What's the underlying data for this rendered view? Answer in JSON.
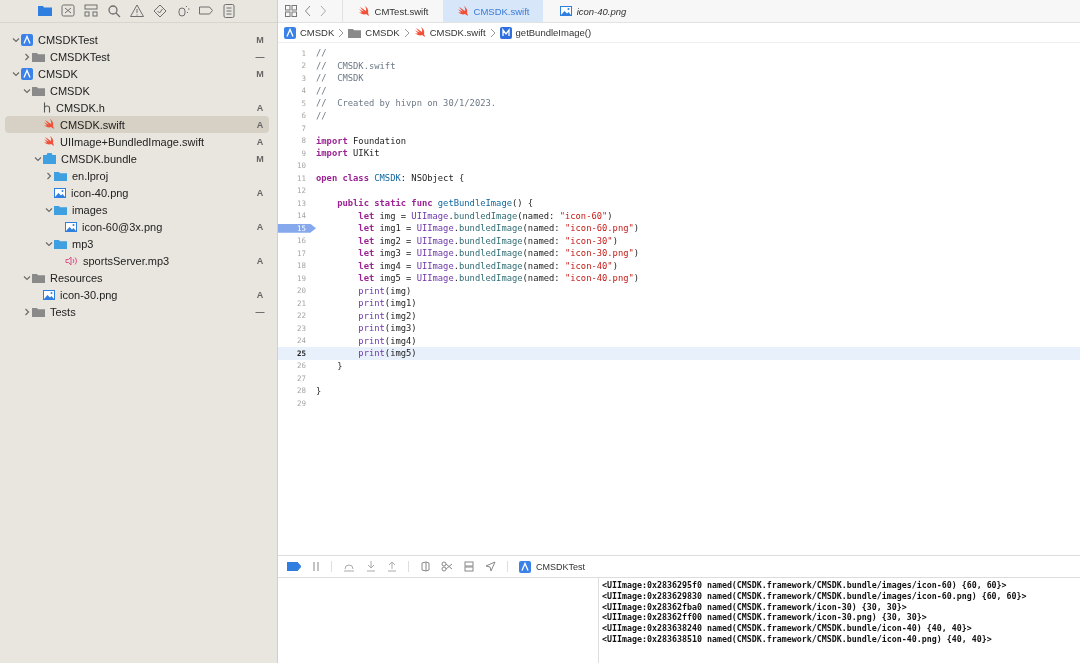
{
  "navigator_tabs": [
    {
      "kind": "folder",
      "selected": true
    },
    {
      "kind": "source-control",
      "selected": false
    },
    {
      "kind": "hierarchy",
      "selected": false
    },
    {
      "kind": "search",
      "selected": false
    },
    {
      "kind": "warning",
      "selected": false
    },
    {
      "kind": "test",
      "selected": false
    },
    {
      "kind": "debug",
      "selected": false
    },
    {
      "kind": "breakpoint",
      "selected": false
    },
    {
      "kind": "report",
      "selected": false
    }
  ],
  "tree": [
    {
      "label": "CMSDKTest",
      "kind": "project",
      "status": "M",
      "expanded": true,
      "selected": false,
      "children": [
        {
          "label": "CMSDKTest",
          "kind": "folder",
          "status": "—",
          "expanded": false,
          "selected": false
        }
      ]
    },
    {
      "label": "CMSDK",
      "kind": "project",
      "status": "M",
      "expanded": true,
      "selected": false,
      "children": [
        {
          "label": "CMSDK",
          "kind": "folder",
          "expanded": true,
          "selected": false,
          "children": [
            {
              "label": "CMSDK.h",
              "kind": "header",
              "status": "A",
              "selected": false
            },
            {
              "label": "CMSDK.swift",
              "kind": "swift",
              "status": "A",
              "selected": true
            },
            {
              "label": "UIImage+BundledImage.swift",
              "kind": "swift",
              "status": "A",
              "selected": false
            },
            {
              "label": "CMSDK.bundle",
              "kind": "bundle",
              "status": "M",
              "expanded": true,
              "selected": false,
              "children": [
                {
                  "label": "en.lproj",
                  "kind": "bluefolder",
                  "expanded": false,
                  "selected": false
                },
                {
                  "label": "icon-40.png",
                  "kind": "image",
                  "status": "A",
                  "selected": false
                },
                {
                  "label": "images",
                  "kind": "bluefolder",
                  "expanded": true,
                  "selected": false,
                  "children": [
                    {
                      "label": "icon-60@3x.png",
                      "kind": "image",
                      "status": "A",
                      "selected": false
                    }
                  ]
                },
                {
                  "label": "mp3",
                  "kind": "bluefolder",
                  "expanded": true,
                  "selected": false,
                  "children": [
                    {
                      "label": "sportsServer.mp3",
                      "kind": "audio",
                      "status": "A",
                      "selected": false
                    }
                  ]
                }
              ]
            }
          ]
        },
        {
          "label": "Resources",
          "kind": "folder",
          "expanded": true,
          "selected": false,
          "children": [
            {
              "label": "icon-30.png",
              "kind": "image",
              "status": "A",
              "selected": false
            }
          ]
        },
        {
          "label": "Tests",
          "kind": "folder",
          "status": "—",
          "expanded": false,
          "selected": false
        }
      ]
    }
  ],
  "tabs": [
    {
      "label": "CMTest.swift",
      "kind": "swift",
      "preview": false,
      "selected": false
    },
    {
      "label": "CMSDK.swift",
      "kind": "swift",
      "preview": false,
      "selected": true
    },
    {
      "label": "icon-40.png",
      "kind": "image",
      "preview": true,
      "selected": false
    }
  ],
  "breadcrumb": [
    {
      "label": "CMSDK",
      "kind": "project"
    },
    {
      "label": "CMSDK",
      "kind": "folder"
    },
    {
      "label": "CMSDK.swift",
      "kind": "swift"
    },
    {
      "label": "getBundleImage()",
      "kind": "method"
    }
  ],
  "code_lines": [
    {
      "number": "1",
      "tokens": [
        {
          "kind": "comment",
          "text": "//"
        }
      ]
    },
    {
      "number": "2",
      "tokens": [
        {
          "kind": "comment",
          "text": "//  CMSDK.swift"
        }
      ]
    },
    {
      "number": "3",
      "tokens": [
        {
          "kind": "comment",
          "text": "//  CMSDK"
        }
      ]
    },
    {
      "number": "4",
      "tokens": [
        {
          "kind": "comment",
          "text": "//"
        }
      ]
    },
    {
      "number": "5",
      "tokens": [
        {
          "kind": "comment",
          "text": "//  Created by hivpn on 30/1/2023."
        }
      ]
    },
    {
      "number": "6",
      "tokens": [
        {
          "kind": "comment",
          "text": "//"
        }
      ]
    },
    {
      "number": "7"
    },
    {
      "number": "8",
      "tokens": [
        {
          "kind": "keyword",
          "text": "import"
        },
        {
          "kind": "plain",
          "text": " Foundation"
        }
      ]
    },
    {
      "number": "9",
      "tokens": [
        {
          "kind": "keyword",
          "text": "import"
        },
        {
          "kind": "plain",
          "text": " UIKit"
        }
      ]
    },
    {
      "number": "10"
    },
    {
      "number": "11",
      "tokens": [
        {
          "kind": "keyword",
          "text": "open"
        },
        {
          "kind": "keyword",
          "text": " class"
        },
        {
          "kind": "declaration",
          "text": " CMSDK"
        },
        {
          "kind": "plain",
          "text": ": NSObject {"
        }
      ]
    },
    {
      "number": "12"
    },
    {
      "number": "13",
      "tokens": [
        {
          "kind": "keyword",
          "text": "    public"
        },
        {
          "kind": "keyword",
          "text": " static"
        },
        {
          "kind": "keyword",
          "text": " func"
        },
        {
          "kind": "declaration",
          "text": " getBundleImage"
        },
        {
          "kind": "plain",
          "text": "() {"
        }
      ]
    },
    {
      "number": "14",
      "tokens": [
        {
          "kind": "keyword",
          "text": "        let"
        },
        {
          "kind": "plain",
          "text": " img = "
        },
        {
          "kind": "type",
          "text": "UIImage"
        },
        {
          "kind": "plain",
          "text": "."
        },
        {
          "kind": "call",
          "text": "bundledImage"
        },
        {
          "kind": "plain",
          "text": "(named: "
        },
        {
          "kind": "string",
          "text": "\"icon-60\""
        },
        {
          "kind": "plain",
          "text": ")"
        }
      ]
    },
    {
      "number": "15",
      "breakpoint": true,
      "tokens": [
        {
          "kind": "keyword",
          "text": "        let"
        },
        {
          "kind": "plain",
          "text": " img1 = "
        },
        {
          "kind": "type",
          "text": "UIImage"
        },
        {
          "kind": "plain",
          "text": "."
        },
        {
          "kind": "call",
          "text": "bundledImage"
        },
        {
          "kind": "plain",
          "text": "(named: "
        },
        {
          "kind": "string",
          "text": "\"icon-60.png\""
        },
        {
          "kind": "plain",
          "text": ")"
        }
      ]
    },
    {
      "number": "16",
      "tokens": [
        {
          "kind": "keyword",
          "text": "        let"
        },
        {
          "kind": "plain",
          "text": " img2 = "
        },
        {
          "kind": "type",
          "text": "UIImage"
        },
        {
          "kind": "plain",
          "text": "."
        },
        {
          "kind": "call",
          "text": "bundledImage"
        },
        {
          "kind": "plain",
          "text": "(named: "
        },
        {
          "kind": "string",
          "text": "\"icon-30\""
        },
        {
          "kind": "plain",
          "text": ")"
        }
      ]
    },
    {
      "number": "17",
      "tokens": [
        {
          "kind": "keyword",
          "text": "        let"
        },
        {
          "kind": "plain",
          "text": " img3 = "
        },
        {
          "kind": "type",
          "text": "UIImage"
        },
        {
          "kind": "plain",
          "text": "."
        },
        {
          "kind": "call",
          "text": "bundledImage"
        },
        {
          "kind": "plain",
          "text": "(named: "
        },
        {
          "kind": "string",
          "text": "\"icon-30.png\""
        },
        {
          "kind": "plain",
          "text": ")"
        }
      ]
    },
    {
      "number": "18",
      "tokens": [
        {
          "kind": "keyword",
          "text": "        let"
        },
        {
          "kind": "plain",
          "text": " img4 = "
        },
        {
          "kind": "type",
          "text": "UIImage"
        },
        {
          "kind": "plain",
          "text": "."
        },
        {
          "kind": "call",
          "text": "bundledImage"
        },
        {
          "kind": "plain",
          "text": "(named: "
        },
        {
          "kind": "string",
          "text": "\"icon-40\""
        },
        {
          "kind": "plain",
          "text": ")"
        }
      ]
    },
    {
      "number": "19",
      "tokens": [
        {
          "kind": "keyword",
          "text": "        let"
        },
        {
          "kind": "plain",
          "text": " img5 = "
        },
        {
          "kind": "type",
          "text": "UIImage"
        },
        {
          "kind": "plain",
          "text": "."
        },
        {
          "kind": "call",
          "text": "bundledImage"
        },
        {
          "kind": "plain",
          "text": "(named: "
        },
        {
          "kind": "string",
          "text": "\"icon-40.png\""
        },
        {
          "kind": "plain",
          "text": ")"
        }
      ]
    },
    {
      "number": "20",
      "tokens": [
        {
          "kind": "type",
          "text": "        print"
        },
        {
          "kind": "plain",
          "text": "(img)"
        }
      ]
    },
    {
      "number": "21",
      "tokens": [
        {
          "kind": "type",
          "text": "        print"
        },
        {
          "kind": "plain",
          "text": "(img1)"
        }
      ]
    },
    {
      "number": "22",
      "tokens": [
        {
          "kind": "type",
          "text": "        print"
        },
        {
          "kind": "plain",
          "text": "(img2)"
        }
      ]
    },
    {
      "number": "23",
      "tokens": [
        {
          "kind": "type",
          "text": "        print"
        },
        {
          "kind": "plain",
          "text": "(img3)"
        }
      ]
    },
    {
      "number": "24",
      "tokens": [
        {
          "kind": "type",
          "text": "        print"
        },
        {
          "kind": "plain",
          "text": "(img4)"
        }
      ]
    },
    {
      "number": "25",
      "current": true,
      "tokens": [
        {
          "kind": "type",
          "text": "        print"
        },
        {
          "kind": "plain",
          "text": "(img5)"
        }
      ]
    },
    {
      "number": "26",
      "tokens": [
        {
          "kind": "plain",
          "text": "    }"
        }
      ]
    },
    {
      "number": "27"
    },
    {
      "number": "28",
      "tokens": [
        {
          "kind": "plain",
          "text": "}"
        }
      ]
    },
    {
      "number": "29"
    }
  ],
  "debug_bar": {
    "breakpoints_active": true,
    "scheme": "CMSDKTest"
  },
  "console_output": [
    "<UIImage:0x2836295f0 named(CMSDK.framework/CMSDK.bundle/images/icon-60) {60, 60}>",
    "<UIImage:0x283629830 named(CMSDK.framework/CMSDK.bundle/images/icon-60.png) {60, 60}>",
    "<UIImage:0x28362fba0 named(CMSDK.framework/icon-30) {30, 30}>",
    "<UIImage:0x28362ff00 named(CMSDK.framework/icon-30.png) {30, 30}>",
    "<UIImage:0x283638240 named(CMSDK.framework/CMSDK.bundle/icon-40) {40, 40}>",
    "<UIImage:0x283638510 named(CMSDK.framework/CMSDK.bundle/icon-40.png) {40, 40}>"
  ]
}
